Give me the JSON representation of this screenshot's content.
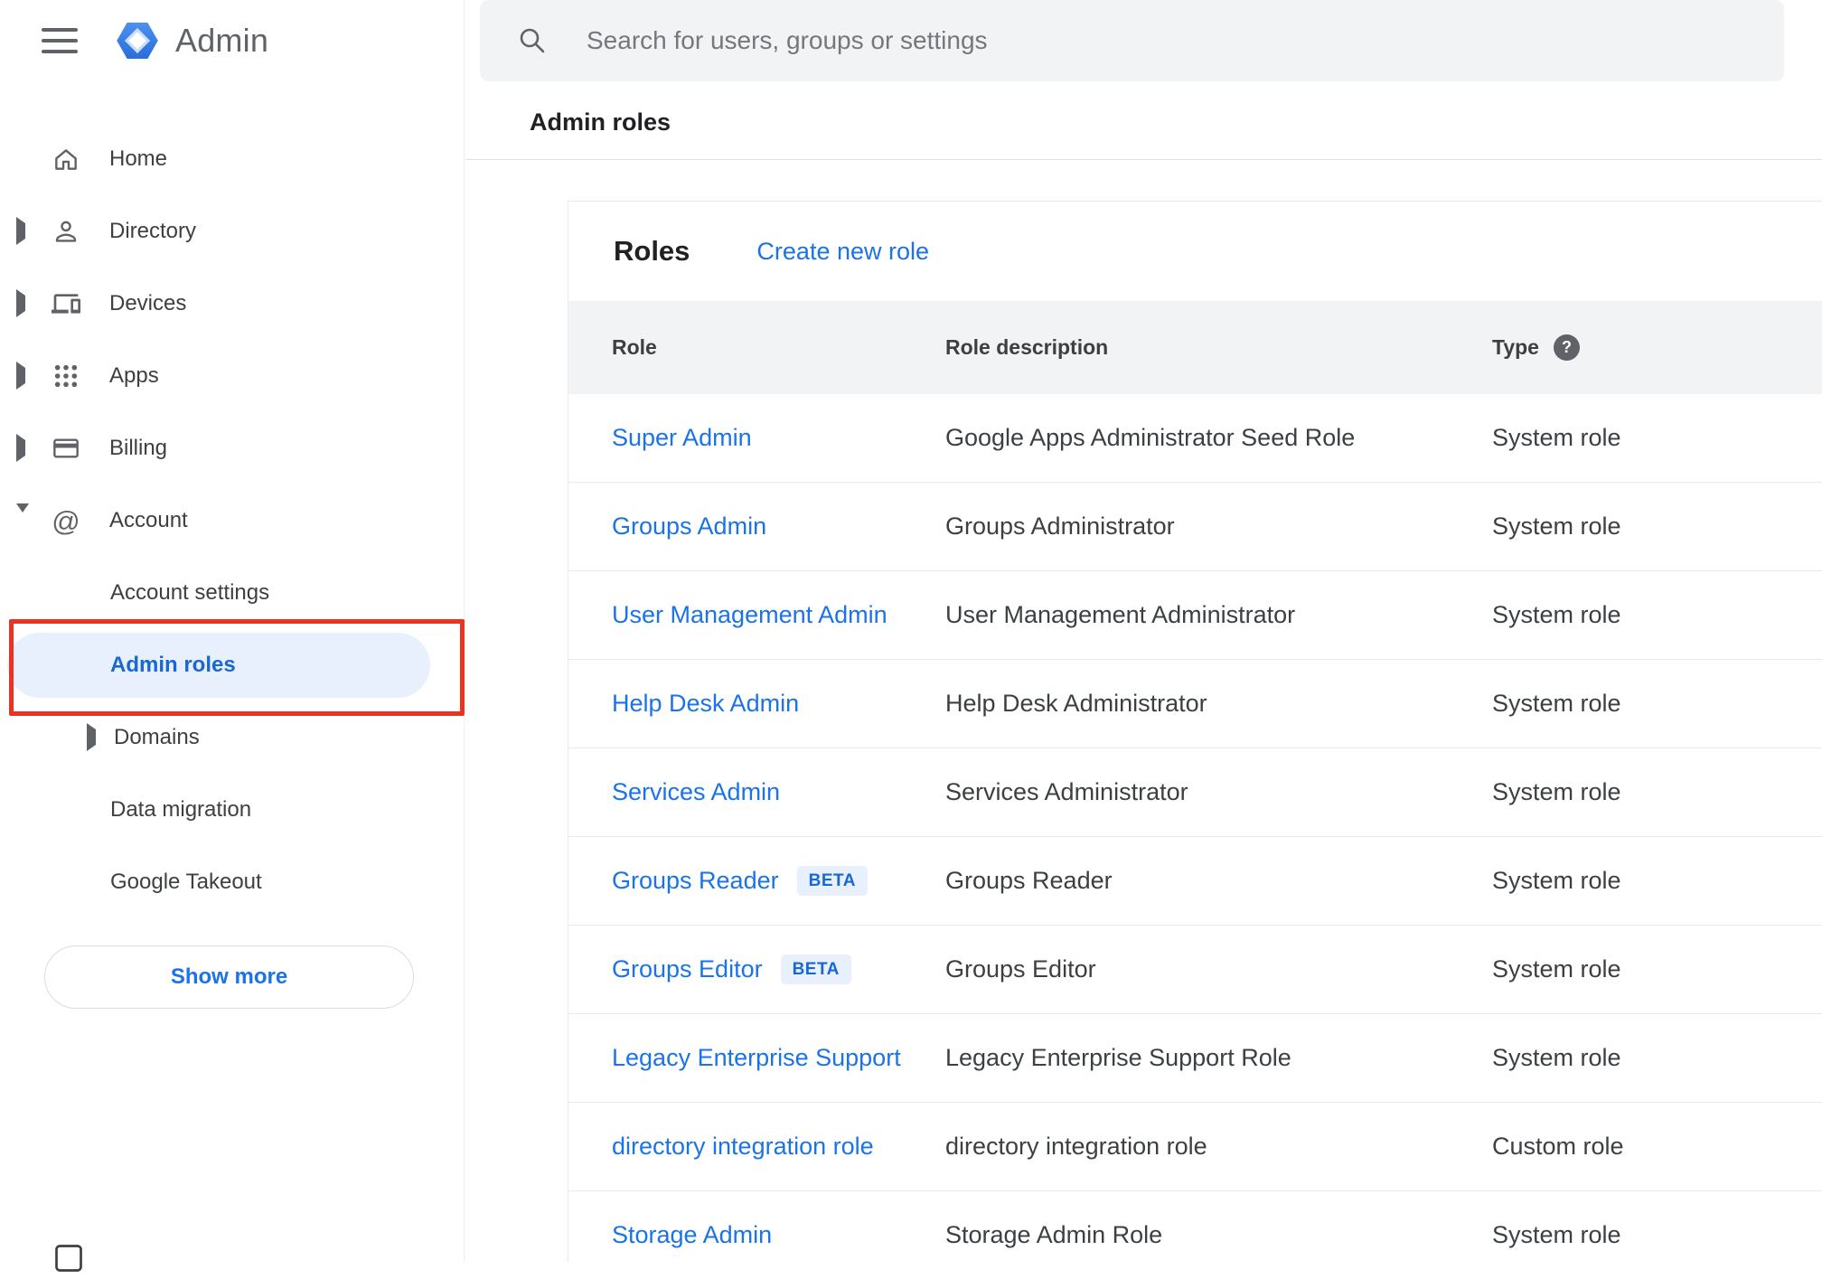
{
  "app": {
    "title": "Admin"
  },
  "search": {
    "placeholder": "Search for users, groups or settings"
  },
  "page": {
    "breadcrumb": "Admin roles"
  },
  "sidebar": {
    "items": [
      {
        "label": "Home"
      },
      {
        "label": "Directory"
      },
      {
        "label": "Devices"
      },
      {
        "label": "Apps"
      },
      {
        "label": "Billing"
      },
      {
        "label": "Account"
      }
    ],
    "account_children": [
      {
        "label": "Account settings"
      },
      {
        "label": "Admin roles",
        "selected": true
      },
      {
        "label": "Domains"
      },
      {
        "label": "Data migration"
      },
      {
        "label": "Google Takeout"
      }
    ],
    "show_more": "Show more"
  },
  "roles": {
    "title": "Roles",
    "create_link": "Create new role",
    "columns": [
      "Role",
      "Role description",
      "Type"
    ],
    "beta_label": "BETA",
    "rows": [
      {
        "role": "Super Admin",
        "beta": false,
        "description": "Google Apps Administrator Seed Role",
        "type": "System role"
      },
      {
        "role": "Groups Admin",
        "beta": false,
        "description": "Groups Administrator",
        "type": "System role"
      },
      {
        "role": "User Management Admin",
        "beta": false,
        "description": "User Management Administrator",
        "type": "System role"
      },
      {
        "role": "Help Desk Admin",
        "beta": false,
        "description": "Help Desk Administrator",
        "type": "System role"
      },
      {
        "role": "Services Admin",
        "beta": false,
        "description": "Services Administrator",
        "type": "System role"
      },
      {
        "role": "Groups Reader",
        "beta": true,
        "description": "Groups Reader",
        "type": "System role"
      },
      {
        "role": "Groups Editor",
        "beta": true,
        "description": "Groups Editor",
        "type": "System role"
      },
      {
        "role": "Legacy Enterprise Support",
        "beta": false,
        "description": "Legacy Enterprise Support Role",
        "type": "System role"
      },
      {
        "role": "directory integration role",
        "beta": false,
        "description": "directory integration role",
        "type": "Custom role"
      },
      {
        "role": "Storage Admin",
        "beta": false,
        "description": "Storage Admin Role",
        "type": "System role"
      }
    ]
  },
  "colors": {
    "accent_blue": "#1a73e8",
    "selected_blue": "#1967d2",
    "selected_bg": "#e8f0fe",
    "search_bg": "#f1f3f4",
    "table_header_bg": "#f1f3f4",
    "annotation_red": "#ea3323",
    "logo_blue": "#4285f4"
  }
}
